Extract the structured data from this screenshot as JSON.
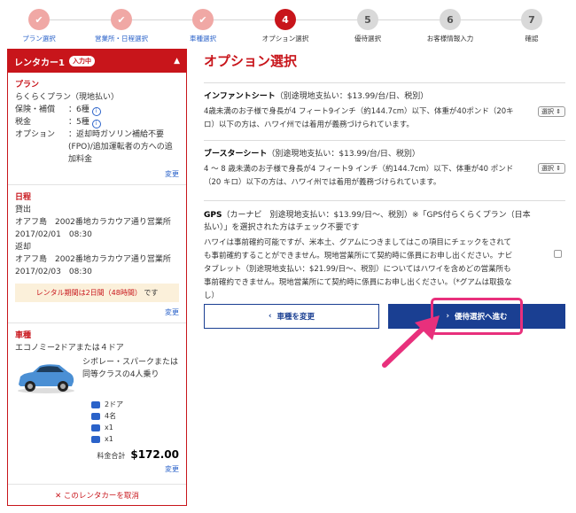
{
  "steps": [
    {
      "num": "1",
      "label": "プラン選択",
      "state": "done"
    },
    {
      "num": "2",
      "label": "営業所・日程選択",
      "state": "done"
    },
    {
      "num": "3",
      "label": "車種選択",
      "state": "done"
    },
    {
      "num": "4",
      "label": "オプション選択",
      "state": "current"
    },
    {
      "num": "5",
      "label": "優待選択",
      "state": "todo"
    },
    {
      "num": "6",
      "label": "お客様情報入力",
      "state": "todo"
    },
    {
      "num": "7",
      "label": "確認",
      "state": "todo"
    }
  ],
  "sidebar": {
    "title": "レンタカー1",
    "badge": "入力中",
    "plan": {
      "heading": "プラン",
      "name": "らくらくプラン（現地払い）",
      "coverage_label": "保険・補償",
      "coverage_value": "：6種",
      "tax_label": "税金",
      "tax_value": "：5種",
      "option_label": "オプション",
      "option_value": "：返却時ガソリン補給不要(FPO)/追加運転者の方への追加料金",
      "change": "変更"
    },
    "schedule": {
      "heading": "日程",
      "pickup_label": "貸出",
      "pickup_place": "オアフ島　2002番地カラカウア通り営業所",
      "pickup_time": "2017/02/01　08:30",
      "return_label": "返却",
      "return_place": "オアフ島　2002番地カラカウア通り営業所",
      "return_time": "2017/02/03　08:30",
      "period_text": "レンタル期間は2日間（48時間）",
      "period_unit": "です",
      "change": "変更"
    },
    "car": {
      "heading": "車種",
      "class": "エコノミー2ドアまたは４ドア",
      "model": "シボレー・スパークまたは同等クラスの4人乗り",
      "specs": [
        "2ドア",
        "4名",
        "x1",
        "x1"
      ],
      "total_label": "料金合計",
      "total_value": "$172.00",
      "change": "変更"
    },
    "cancel": "✕ このレンタカーを取消"
  },
  "main": {
    "title": "オプション選択",
    "options": [
      {
        "name": "インファントシート",
        "price": "（別途現地支払い：$13.99/台/日、税別）",
        "desc": "4歳未満のお子様で身長が4 フィート9インチ（約144.7cm）以下、体重が40ポンド（20キロ）以下の方は、ハワイ州では着用が義務づけられています。",
        "control": "選択"
      },
      {
        "name": "ブースターシート",
        "price": "（別途現地支払い：$13.99/台/日、税別）",
        "desc": "4 ～ 8 歳未満のお子様で身長が4 フィート9 インチ（約144.7cm）以下、体重が40 ポンド（20 キロ）以下の方は、ハワイ州では着用が義務づけられています。",
        "control": "選択"
      },
      {
        "name": "GPS",
        "price": "（カーナビ　別途現地支払い：$13.99/日～、税別）※「GPS付らくらくプラン（日本払い）」を選択された方はチェック不要です",
        "desc": "ハワイは事前確約可能ですが、米本土、グアムにつきましてはこの項目にチェックをされても事前確約することができません。現地営業所にて契約時に係員にお申し出ください。ナビタブレット（別途現地支払い：$21.99/日～、税別）についてはハワイを含めどの営業所も事前確約できません。現地営業所にて契約時に係員にお申し出ください。（*グアムは取扱なし）"
      }
    ],
    "back_button": "車種を変更",
    "next_button": "優待選択へ進む"
  },
  "colors": {
    "brand_red": "#c8151b",
    "navy": "#1a3f92",
    "link_blue": "#2a62c9",
    "highlight_pink": "#e8307c"
  }
}
